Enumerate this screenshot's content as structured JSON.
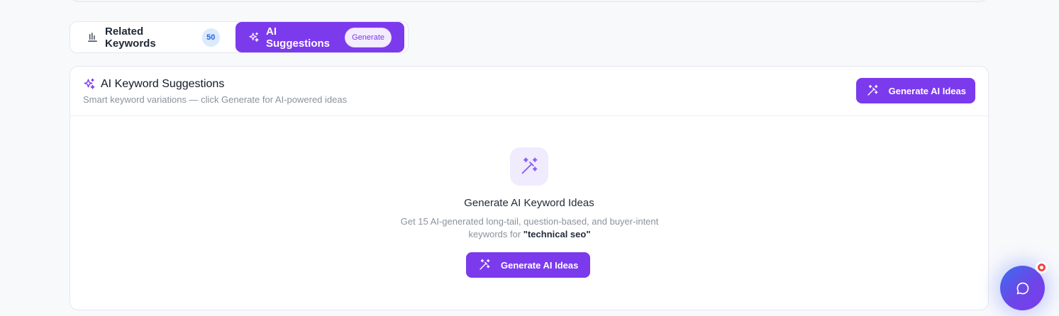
{
  "tabs": {
    "related": {
      "label": "Related Keywords",
      "count": "50",
      "icon": "bar-chart-icon"
    },
    "ai": {
      "label": "AI Suggestions",
      "badge": "Generate",
      "icon": "sparkles-icon"
    }
  },
  "card": {
    "title": "AI Keyword Suggestions",
    "subtitle": "Smart keyword variations — click Generate for AI-powered ideas",
    "header_button": "Generate AI Ideas"
  },
  "empty_state": {
    "icon": "magic-wand-icon",
    "title": "Generate AI Keyword Ideas",
    "desc_prefix": "Get 15 AI-generated long-tail, question-based, and buyer-intent keywords for ",
    "keyword": "\"technical seo\"",
    "button": "Generate AI Ideas"
  },
  "chat": {
    "icon": "chat-bubble-icon"
  },
  "colors": {
    "accent": "#7c3aed",
    "badge_blue": "#2563eb",
    "muted": "#8b929d"
  }
}
